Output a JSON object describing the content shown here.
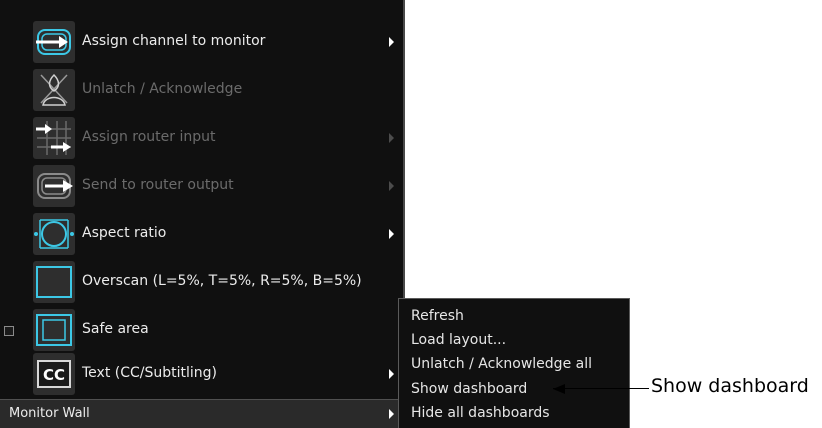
{
  "menu": {
    "items": [
      {
        "label": "Assign channel to monitor",
        "icon": "assign-channel-icon",
        "enabled": true,
        "submenu": true
      },
      {
        "label": "Unlatch / Acknowledge",
        "icon": "unlatch-icon",
        "enabled": false,
        "submenu": false
      },
      {
        "label": "Assign router input",
        "icon": "router-input-icon",
        "enabled": false,
        "submenu": true
      },
      {
        "label": "Send to router output",
        "icon": "router-output-icon",
        "enabled": false,
        "submenu": true
      },
      {
        "label": "Aspect ratio",
        "icon": "aspect-ratio-icon",
        "enabled": true,
        "submenu": true
      },
      {
        "label": "Overscan (L=5%, T=5%, R=5%, B=5%)",
        "icon": "overscan-icon",
        "enabled": true,
        "submenu": false
      },
      {
        "label": "Safe area",
        "icon": "safe-area-icon",
        "enabled": true,
        "submenu": false,
        "checked": false
      },
      {
        "label": "Text (CC/Subtitling)",
        "icon": "cc-icon",
        "icon_text": "CC",
        "enabled": true,
        "submenu": true
      }
    ],
    "bottom_bar": {
      "label": "Monitor Wall"
    }
  },
  "submenu": {
    "items": [
      "Refresh",
      "Load layout...",
      "Unlatch / Acknowledge all",
      "Show dashboard",
      "Hide all dashboards"
    ]
  },
  "callout": {
    "label": "Show dashboard"
  },
  "colors": {
    "accent": "#3cc8e6",
    "menu_bg": "#101010",
    "icon_bg": "#2e2e2e",
    "disabled_text": "#6b6b6b"
  }
}
